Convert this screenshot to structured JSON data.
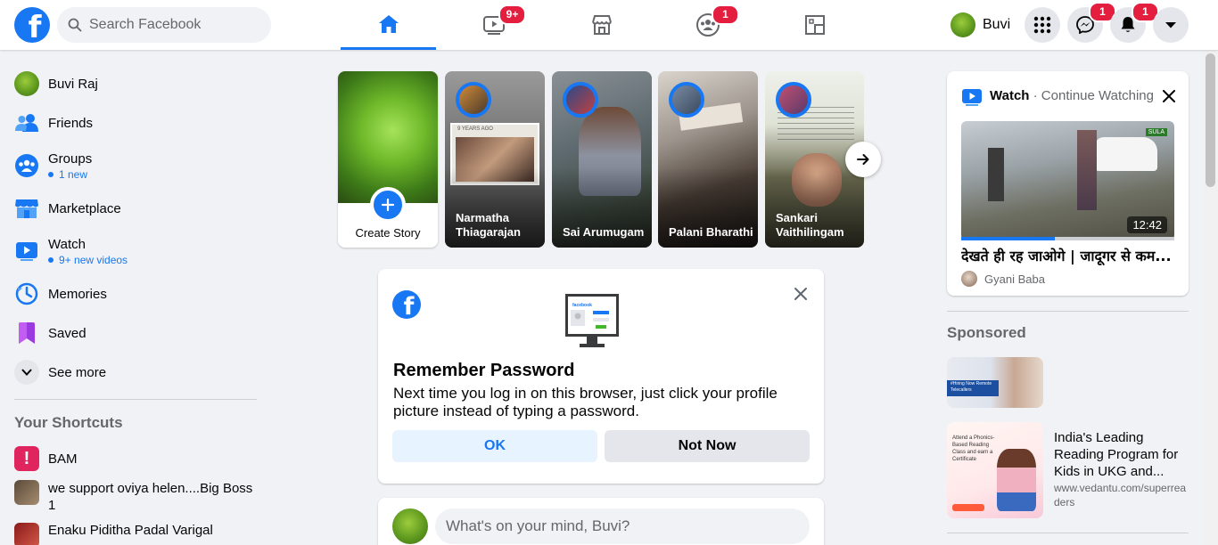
{
  "topbar": {
    "search_placeholder": "Search Facebook",
    "tabs": [
      {
        "name": "home",
        "active": true,
        "badge": ""
      },
      {
        "name": "watch",
        "active": false,
        "badge": "9+"
      },
      {
        "name": "marketplace",
        "active": false,
        "badge": ""
      },
      {
        "name": "groups",
        "active": false,
        "badge": "1"
      },
      {
        "name": "gaming",
        "active": false,
        "badge": ""
      }
    ],
    "profile_name": "Buvi",
    "messenger_badge": "1",
    "notifications_badge": "1"
  },
  "sidebar": {
    "items": [
      {
        "label": "Buvi Raj",
        "sub": ""
      },
      {
        "label": "Friends",
        "sub": ""
      },
      {
        "label": "Groups",
        "sub": "1 new"
      },
      {
        "label": "Marketplace",
        "sub": ""
      },
      {
        "label": "Watch",
        "sub": "9+ new videos"
      },
      {
        "label": "Memories",
        "sub": ""
      },
      {
        "label": "Saved",
        "sub": ""
      },
      {
        "label": "See more",
        "sub": ""
      }
    ],
    "shortcuts_title": "Your Shortcuts",
    "shortcuts": [
      {
        "label": "BAM"
      },
      {
        "label": "we support oviya helen....Big Boss 1"
      },
      {
        "label": "Enaku Piditha Padal Varigal"
      }
    ]
  },
  "stories": {
    "create_label": "Create Story",
    "items": [
      {
        "name": "Narmatha Thiagarajan"
      },
      {
        "name": "Sai Arumugam"
      },
      {
        "name": "Palani Bharathi"
      },
      {
        "name": "Sankari Vaithilingam"
      }
    ],
    "memory_tag": "9 YEARS AGO"
  },
  "remember_password": {
    "title": "Remember Password",
    "body": "Next time you log in on this browser, just click your profile picture instead of typing a password.",
    "ok_label": "OK",
    "not_now_label": "Not Now",
    "illustration_brand": "facebook"
  },
  "composer": {
    "placeholder": "What's on your mind, Buvi?"
  },
  "watch_card": {
    "title": "Watch",
    "separator": " · ",
    "subtitle": "Continue Watching",
    "duration": "12:42",
    "video_title": "देखते ही रह जाओगे | जादूगर से कम...",
    "channel": "Gyani Baba",
    "progress": 0.44,
    "overlay_tag": "SULA"
  },
  "sponsored": {
    "title": "Sponsored",
    "ads": [
      {
        "title": "",
        "url": "",
        "thumb_text": "#Hiring Now Remote Telecallers"
      },
      {
        "title": "India's Leading Reading Program for Kids in UKG and...",
        "url": "www.vedantu.com/superreaders",
        "thumb_text": "Attend a Phonics-Based Reading Class and earn a Certificate"
      }
    ]
  },
  "colors": {
    "brand": "#1877f2",
    "badge": "#e41e3f",
    "background": "#f0f2f5"
  }
}
